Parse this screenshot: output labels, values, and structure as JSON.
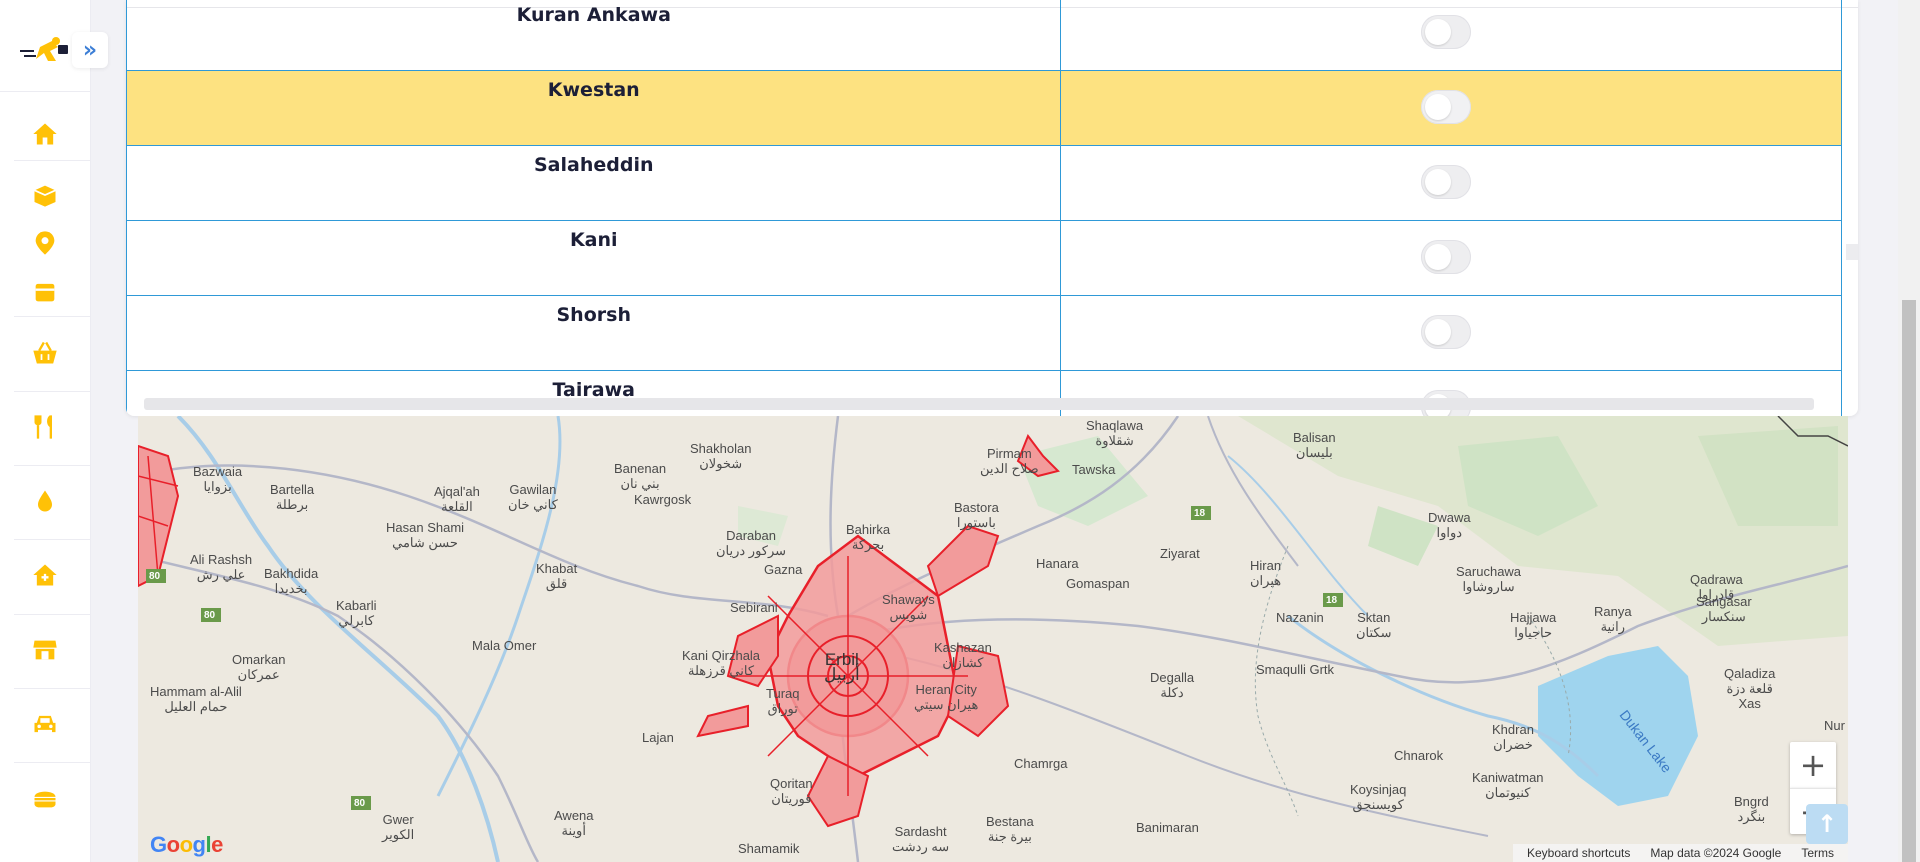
{
  "sidebar": {
    "expand_label": "»",
    "items": [
      {
        "icon": "home-icon",
        "label": ""
      },
      {
        "icon": "box-open-icon",
        "label": ""
      },
      {
        "icon": "map-pin-icon",
        "label": ""
      },
      {
        "icon": "package-icon",
        "label": ""
      },
      {
        "icon": "basket-icon",
        "label": ""
      },
      {
        "icon": "utensils-icon",
        "label": ""
      },
      {
        "icon": "drop-icon",
        "label": ""
      },
      {
        "icon": "home-plus-icon",
        "label": ""
      },
      {
        "icon": "store-icon",
        "label": ""
      },
      {
        "icon": "car-icon",
        "label": ""
      },
      {
        "icon": "burger-icon",
        "label": ""
      }
    ]
  },
  "zones": [
    {
      "name": "Kuran Ankawa",
      "active": false
    },
    {
      "name": "Kwestan",
      "active": false
    },
    {
      "name": "Salaheddin",
      "active": false
    },
    {
      "name": "Kani",
      "active": false
    },
    {
      "name": "Shorsh",
      "active": false
    },
    {
      "name": "Tairawa",
      "active": false
    }
  ],
  "map": {
    "places": [
      {
        "name": "Shakholan",
        "alt": "شخولان"
      },
      {
        "name": "Banenan",
        "alt": "بني نان"
      },
      {
        "name": "Kawrgosk",
        "alt": ""
      },
      {
        "name": "Bazwaia",
        "alt": "بزوايا"
      },
      {
        "name": "Bartella",
        "alt": "برطلة"
      },
      {
        "name": "Ajqal'ah",
        "alt": "القلعة"
      },
      {
        "name": "Gawilan",
        "alt": "كاني خان"
      },
      {
        "name": "Hasan Shami",
        "alt": "حسن شامي"
      },
      {
        "name": "Ali Rashsh",
        "alt": "علي رش"
      },
      {
        "name": "Bakhdida",
        "alt": "بخديدا"
      },
      {
        "name": "Khabat",
        "alt": "قلق"
      },
      {
        "name": "Daraban",
        "alt": "سركور دريان"
      },
      {
        "name": "Bahirka",
        "alt": "بحركة"
      },
      {
        "name": "Pirmam",
        "alt": "صلاح الدين"
      },
      {
        "name": "Tawska",
        "alt": ""
      },
      {
        "name": "Shaqlawa",
        "alt": "شقلاوة"
      },
      {
        "name": "Bastora",
        "alt": "باستورا"
      },
      {
        "name": "Balisan",
        "alt": "بليسان"
      },
      {
        "name": "Hanara",
        "alt": ""
      },
      {
        "name": "Ziyarat",
        "alt": ""
      },
      {
        "name": "Hiran",
        "alt": "هيران"
      },
      {
        "name": "Dwawa",
        "alt": "دواوا"
      },
      {
        "name": "Saruchawa",
        "alt": "ساروشاوا"
      },
      {
        "name": "Qadrawa",
        "alt": "قادراوا"
      },
      {
        "name": "Sangasar",
        "alt": "سنكسار"
      },
      {
        "name": "Gazna",
        "alt": ""
      },
      {
        "name": "Shaways",
        "alt": "شويس"
      },
      {
        "name": "Gomaspan",
        "alt": ""
      },
      {
        "name": "Sebirani",
        "alt": ""
      },
      {
        "name": "Nazanin",
        "alt": ""
      },
      {
        "name": "Sktan",
        "alt": "سكتان"
      },
      {
        "name": "Hajjawa",
        "alt": "حاجياوا"
      },
      {
        "name": "Ranya",
        "alt": "رانية"
      },
      {
        "name": "Kabarli",
        "alt": "كابرلي"
      },
      {
        "name": "Kani Qirzhala",
        "alt": "كاني قرزهلة"
      },
      {
        "name": "Erbil",
        "alt": "أربيل"
      },
      {
        "name": "Kashazan",
        "alt": "كشازان"
      },
      {
        "name": "Mala Omer",
        "alt": ""
      },
      {
        "name": "Omarkan",
        "alt": "عمركان"
      },
      {
        "name": "Hammam al-Alil",
        "alt": "حمام العليل"
      },
      {
        "name": "Degalla",
        "alt": "دكلة"
      },
      {
        "name": "Smaqulli Grtk",
        "alt": ""
      },
      {
        "name": "Qaladiza",
        "alt": "قلعة دزة"
      },
      {
        "name": "Xas",
        "alt": ""
      },
      {
        "name": "Turaq",
        "alt": "توراق"
      },
      {
        "name": "Heran City",
        "alt": "هيران سيتي"
      },
      {
        "name": "Lajan",
        "alt": ""
      },
      {
        "name": "Khdran",
        "alt": "خضران"
      },
      {
        "name": "Chnarok",
        "alt": ""
      },
      {
        "name": "Qoritan",
        "alt": "قوريتان"
      },
      {
        "name": "Chamrga",
        "alt": ""
      },
      {
        "name": "Kaniwatman",
        "alt": "كنيوتمان"
      },
      {
        "name": "Koysinjaq",
        "alt": "كويسنجق"
      },
      {
        "name": "Bngrd",
        "alt": "بنگرد"
      },
      {
        "name": "Awena",
        "alt": "أوينة"
      },
      {
        "name": "Gwer",
        "alt": "الكوير"
      },
      {
        "name": "Sardasht",
        "alt": "سه ردشت"
      },
      {
        "name": "Bestana",
        "alt": "بيرة جنة"
      },
      {
        "name": "Banimaran",
        "alt": ""
      },
      {
        "name": "Shamamik",
        "alt": ""
      },
      {
        "name": "Nur",
        "alt": ""
      }
    ],
    "lake": "Dukan Lake",
    "road_shields": [
      "18",
      "18",
      "80",
      "80",
      "80"
    ],
    "zoom_in": "+",
    "zoom_out": "−",
    "google": "Google",
    "attribution": {
      "shortcuts": "Keyboard shortcuts",
      "data": "Map data ©2024 Google",
      "terms": "Terms"
    }
  },
  "back_to_top": "↑",
  "colors": {
    "accent": "#ffc107",
    "highlight_row": "#fde281",
    "table_border": "#2f99d7",
    "zone_fill": "#f29b9b",
    "zone_stroke": "#e8202a"
  }
}
